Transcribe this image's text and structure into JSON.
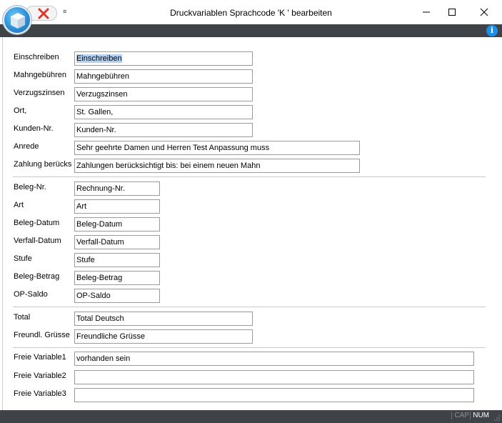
{
  "window": {
    "title": "Druckvariablen Sprachcode 'K ' bearbeiten",
    "quick_access_menu_glyph": "≡"
  },
  "icons": {
    "app": "cube-icon",
    "close_quick": "red-x-icon",
    "info": "info-icon",
    "minimize": "minimize-icon",
    "maximize": "maximize-icon",
    "close": "close-icon"
  },
  "info_glyph": "i",
  "colors": {
    "dark_bar": "#3f4347",
    "accent_blue": "#1e8fe6",
    "close_red": "#e0352b",
    "selection": "#b5d3f1"
  },
  "groups": [
    {
      "fields": [
        {
          "label": "Einschreiben",
          "value": "Einschreiben",
          "selected": true
        },
        {
          "label": "Mahngebühren",
          "value": "Mahngebühren"
        },
        {
          "label": "Verzugszinsen",
          "value": "Verzugszinsen"
        },
        {
          "label": "Ort,",
          "value": "St. Gallen,"
        },
        {
          "label": "Kunden-Nr.",
          "value": "Kunden-Nr."
        },
        {
          "label": "Anrede",
          "value": "Sehr geehrte Damen und Herren Test Anpassung muss"
        },
        {
          "label": "Zahlung berücks",
          "value": "Zahlungen berücksichtigt bis: bei einem neuen Mahn"
        }
      ]
    },
    {
      "fields": [
        {
          "label": "Beleg-Nr.",
          "value": "Rechnung-Nr."
        },
        {
          "label": "Art",
          "value": "Art"
        },
        {
          "label": "Beleg-Datum",
          "value": "Beleg-Datum"
        },
        {
          "label": "Verfall-Datum",
          "value": "Verfall-Datum"
        },
        {
          "label": "Stufe",
          "value": "Stufe"
        },
        {
          "label": "Beleg-Betrag",
          "value": "Beleg-Betrag"
        },
        {
          "label": "OP-Saldo",
          "value": "OP-Saldo"
        }
      ]
    },
    {
      "fields": [
        {
          "label": "Total",
          "value": "Total Deutsch"
        },
        {
          "label": "Freundl. Grüsse",
          "value": "Freundliche Grüsse"
        }
      ]
    },
    {
      "fields": [
        {
          "label": "Freie Variable1",
          "value": "vorhanden sein"
        },
        {
          "label": "Freie Variable2",
          "value": ""
        },
        {
          "label": "Freie Variable3",
          "value": ""
        }
      ]
    }
  ],
  "statusbar": {
    "cap": "CAP",
    "num": "NUM"
  }
}
